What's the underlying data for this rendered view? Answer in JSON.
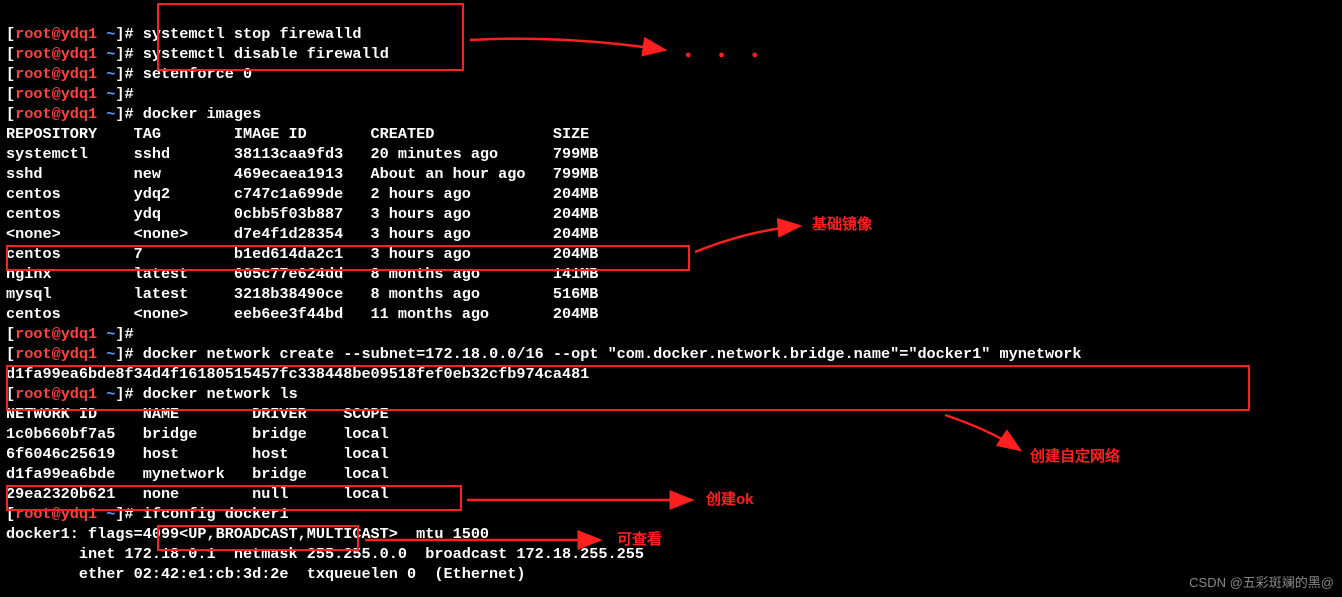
{
  "prompt": {
    "bracket_open": "[",
    "user_host": "root@ydq1",
    "tilde": " ~",
    "bracket_close": "]#",
    "space": " "
  },
  "cmds": {
    "c1": "systemctl stop firewalld",
    "c2": "systemctl disable firewalld",
    "c3": "setenforce 0",
    "c4": "",
    "c5": "docker images",
    "c6": "",
    "c7": "docker network create --subnet=172.18.0.0/16 --opt \"com.docker.network.bridge.name\"=\"docker1\" mynetwork",
    "c8": "docker network ls",
    "c9": "ifconfig docker1"
  },
  "images_header": "REPOSITORY    TAG        IMAGE ID       CREATED             SIZE",
  "images": [
    "systemctl     sshd       38113caa9fd3   20 minutes ago      799MB",
    "sshd          new        469ecaea1913   About an hour ago   799MB",
    "centos        ydq2       c747c1a699de   2 hours ago         204MB",
    "centos        ydq        0cbb5f03b887   3 hours ago         204MB",
    "<none>        <none>     d7e4f1d28354   3 hours ago         204MB",
    "centos        7          b1ed614da2c1   3 hours ago         204MB",
    "nginx         latest     605c77e624dd   8 months ago        141MB",
    "mysql         latest     3218b38490ce   8 months ago        516MB",
    "centos        <none>     eeb6ee3f44bd   11 months ago       204MB"
  ],
  "network_create_out": "d1fa99ea6bde8f34d4f16180515457fc338448be09518fef0eb32cfb974ca481",
  "net_header": "NETWORK ID     NAME        DRIVER    SCOPE",
  "networks": [
    "1c0b660bf7a5   bridge      bridge    local",
    "6f6046c25619   host        host      local",
    "d1fa99ea6bde   mynetwork   bridge    local",
    "29ea2320b621   none        null      local"
  ],
  "ifconfig": [
    "docker1: flags=4099<UP,BROADCAST,MULTICAST>  mtu 1500",
    "        inet 172.18.0.1  netmask 255.255.0.0  broadcast 172.18.255.255",
    "        ether 02:42:e1:cb:3d:2e  txqueuelen 0  (Ethernet)"
  ],
  "annotations": {
    "base_image": "基础镜像",
    "create_custom_net": "创建自定网络",
    "create_ok": "创建ok",
    "can_view": "可查看",
    "ellipsis": "●  ●  ●"
  },
  "watermark": "CSDN @五彩斑斓的黑@"
}
